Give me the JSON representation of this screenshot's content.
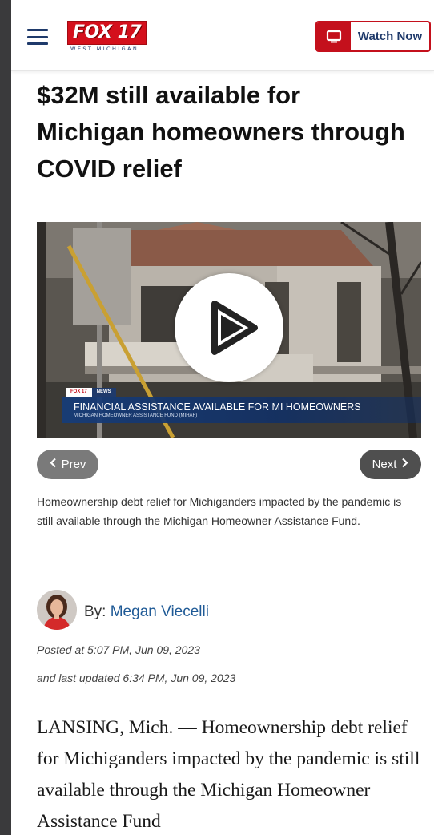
{
  "header": {
    "logo_text": "FOX 17",
    "logo_subtext": "WEST MICHIGAN",
    "watch_now_label": "Watch Now",
    "icons": [
      "menu-icon",
      "tv-icon"
    ],
    "brand_red": "#c4101c",
    "brand_navy": "#1f3a6b"
  },
  "article": {
    "headline": "$32M still available for Michigan homeowners through COVID relief",
    "video": {
      "tag_primary": "FOX 17",
      "tag_secondary": "NEWS",
      "lower_third_title": "FINANCIAL ASSISTANCE AVAILABLE FOR MI HOMEOWNERS",
      "lower_third_subtitle": "MICHIGAN HOMEOWNER ASSISTANCE FUND (MIHAF)",
      "play_icon": "play-icon"
    },
    "gallery_nav": {
      "prev_label": "Prev",
      "next_label": "Next"
    },
    "caption": "Homeownership debt relief for Michiganders impacted by the pandemic is still available through the Michigan Homeowner Assistance Fund.",
    "author": {
      "by_prefix": "By:",
      "name": "Megan Viecelli"
    },
    "posted": "Posted at 5:07 PM, Jun 09, 2023",
    "updated": "and last updated 6:34 PM, Jun 09, 2023",
    "body_first_paragraph": "LANSING, Mich. — Homeownership debt relief for Michiganders impacted by the pandemic is still available through the Michigan Homeowner Assistance Fund"
  }
}
